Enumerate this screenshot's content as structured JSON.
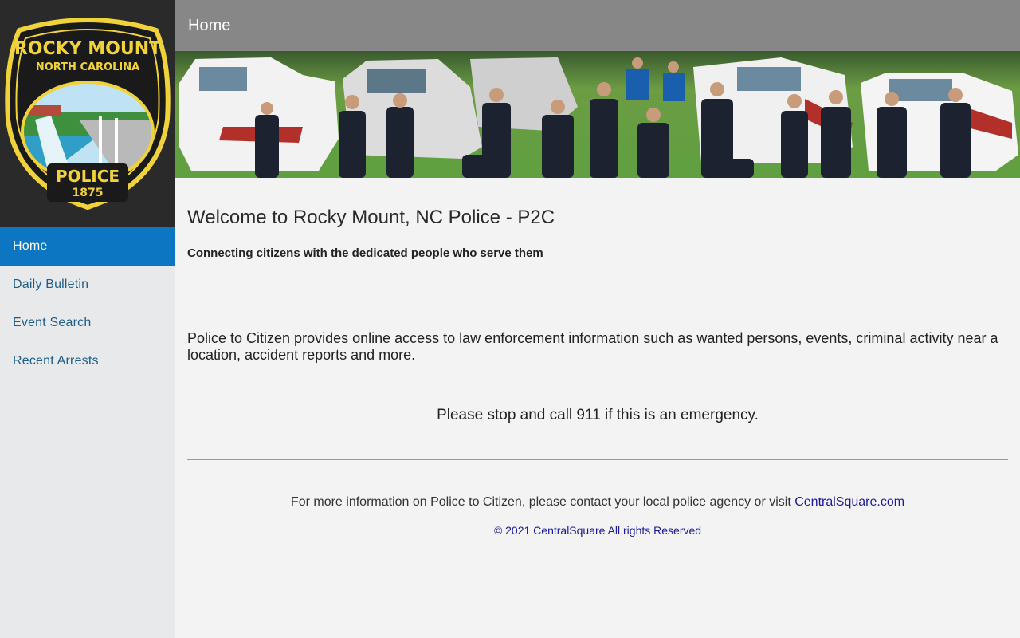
{
  "logo": {
    "title": "ROCKY MOUNT",
    "subtitle": "NORTH CAROLINA",
    "label": "POLICE",
    "year": "1875"
  },
  "sidebar": {
    "items": [
      {
        "label": "Home",
        "active": true
      },
      {
        "label": "Daily Bulletin",
        "active": false
      },
      {
        "label": "Event Search",
        "active": false
      },
      {
        "label": "Recent Arrests",
        "active": false
      }
    ]
  },
  "header": {
    "title": "Home"
  },
  "main": {
    "welcome": "Welcome to Rocky Mount, NC Police - P2C",
    "tagline": "Connecting citizens with the dedicated people who serve them",
    "description": "Police to Citizen provides online access to law enforcement information such as wanted persons, events, criminal activity near a location, accident reports and more.",
    "emergency": "Please stop and call 911 if this is an emergency."
  },
  "footer": {
    "info_text": "For more information on Police to Citizen, please contact your local police agency or visit ",
    "link_text": "CentralSquare.com",
    "copyright": "© 2021 CentralSquare All rights Reserved"
  },
  "colors": {
    "sidebar_bg": "#e8e9ea",
    "active_nav": "#0d76c2",
    "topbar": "#878787",
    "link": "#1a1aa0",
    "badge_gold": "#f0d23a"
  }
}
